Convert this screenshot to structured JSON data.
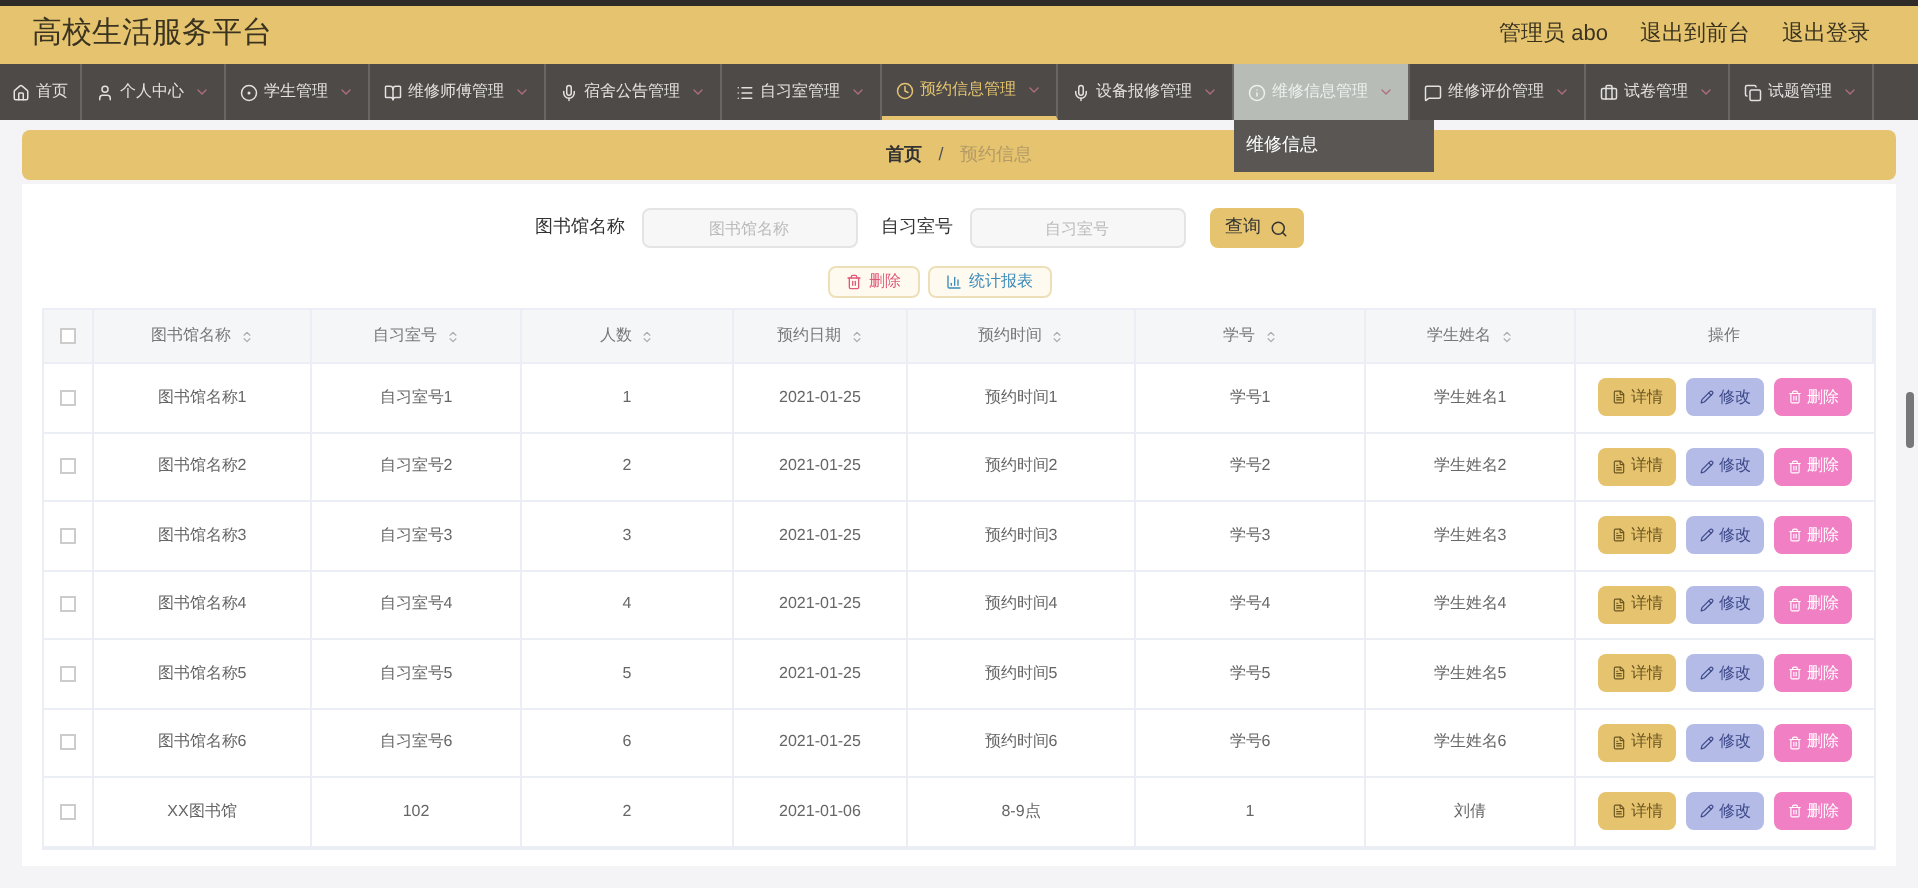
{
  "header": {
    "title": "高校生活服务平台",
    "links": [
      "管理员 abo",
      "退出到前台",
      "退出登录"
    ]
  },
  "nav": [
    {
      "label": "首页",
      "selected": false,
      "hovered": false,
      "dropdown": false
    },
    {
      "label": "个人中心",
      "selected": false,
      "hovered": false,
      "dropdown": true
    },
    {
      "label": "学生管理",
      "selected": false,
      "hovered": false,
      "dropdown": true
    },
    {
      "label": "维修师傅管理",
      "selected": false,
      "hovered": false,
      "dropdown": true
    },
    {
      "label": "宿舍公告管理",
      "selected": false,
      "hovered": false,
      "dropdown": true
    },
    {
      "label": "自习室管理",
      "selected": false,
      "hovered": false,
      "dropdown": true
    },
    {
      "label": "预约信息管理",
      "selected": true,
      "hovered": false,
      "dropdown": true
    },
    {
      "label": "设备报修管理",
      "selected": false,
      "hovered": false,
      "dropdown": true
    },
    {
      "label": "维修信息管理",
      "selected": false,
      "hovered": true,
      "dropdown": true,
      "menu": [
        "维修信息"
      ]
    },
    {
      "label": "维修评价管理",
      "selected": false,
      "hovered": false,
      "dropdown": true
    },
    {
      "label": "试卷管理",
      "selected": false,
      "hovered": false,
      "dropdown": true
    },
    {
      "label": "试题管理",
      "selected": false,
      "hovered": false,
      "dropdown": true
    }
  ],
  "breadcrumb": {
    "items": [
      "首页",
      "预约信息"
    ],
    "separator": "/"
  },
  "search": {
    "fields": [
      {
        "label": "图书馆名称",
        "placeholder": "图书馆名称"
      },
      {
        "label": "自习室号",
        "placeholder": "自习室号"
      }
    ],
    "button": "查询"
  },
  "actions": [
    "删除",
    "统计报表"
  ],
  "table": {
    "all_checked": false,
    "columns": [
      "图书馆名称",
      "自习室号",
      "人数",
      "预约日期",
      "预约时间",
      "学号",
      "学生姓名",
      "操作"
    ],
    "rows": [
      {
        "checked": false,
        "cells": [
          "图书馆名称1",
          "自习室号1",
          "1",
          "2021-01-25",
          "预约时间1",
          "学号1",
          "学生姓名1"
        ],
        "buttons": [
          "详情",
          "修改",
          "删除"
        ]
      },
      {
        "checked": false,
        "cells": [
          "图书馆名称2",
          "自习室号2",
          "2",
          "2021-01-25",
          "预约时间2",
          "学号2",
          "学生姓名2"
        ],
        "buttons": [
          "详情",
          "修改",
          "删除"
        ]
      },
      {
        "checked": false,
        "cells": [
          "图书馆名称3",
          "自习室号3",
          "3",
          "2021-01-25",
          "预约时间3",
          "学号3",
          "学生姓名3"
        ],
        "buttons": [
          "详情",
          "修改",
          "删除"
        ]
      },
      {
        "checked": false,
        "cells": [
          "图书馆名称4",
          "自习室号4",
          "4",
          "2021-01-25",
          "预约时间4",
          "学号4",
          "学生姓名4"
        ],
        "buttons": [
          "详情",
          "修改",
          "删除"
        ]
      },
      {
        "checked": false,
        "cells": [
          "图书馆名称5",
          "自习室号5",
          "5",
          "2021-01-25",
          "预约时间5",
          "学号5",
          "学生姓名5"
        ],
        "buttons": [
          "详情",
          "修改",
          "删除"
        ]
      },
      {
        "checked": false,
        "cells": [
          "图书馆名称6",
          "自习室号6",
          "6",
          "2021-01-25",
          "预约时间6",
          "学号6",
          "学生姓名6"
        ],
        "buttons": [
          "详情",
          "修改",
          "删除"
        ]
      },
      {
        "checked": false,
        "cells": [
          "XX图书馆",
          "102",
          "2",
          "2021-01-06",
          "8-9点",
          "1",
          "刘倩"
        ],
        "buttons": [
          "详情",
          "修改",
          "删除"
        ]
      }
    ]
  }
}
